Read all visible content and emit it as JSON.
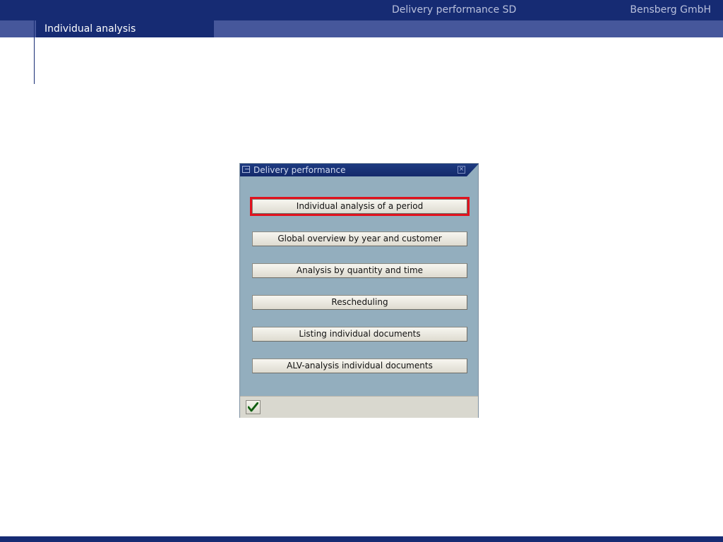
{
  "header": {
    "title": "Delivery performance SD",
    "company": "Bensberg GmbH"
  },
  "subheader": {
    "active_tab": "Individual analysis"
  },
  "dialog": {
    "title": "Delivery performance",
    "buttons": [
      {
        "label": "Individual analysis of a period",
        "selected": true
      },
      {
        "label": "Global overview by year and customer"
      },
      {
        "label": "Analysis by quantity and time"
      },
      {
        "label": "Rescheduling"
      },
      {
        "label": "Listing individual documents"
      },
      {
        "label": "ALV-analysis individual documents"
      }
    ],
    "footer": {
      "confirm_icon": "checkmark-icon"
    }
  },
  "colors": {
    "header_bg": "#162b73",
    "subheader_bg": "#46579b",
    "dialog_bg": "#93aebe",
    "highlight": "#e1121e"
  }
}
